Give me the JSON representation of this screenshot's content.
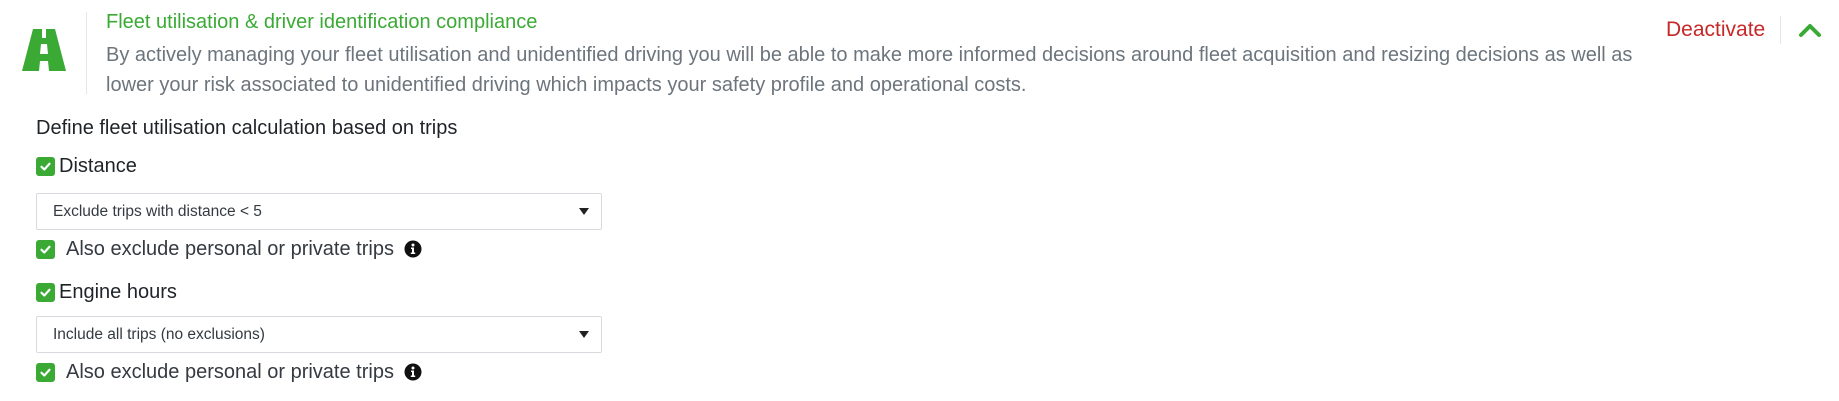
{
  "header": {
    "icon": "road-icon",
    "title": "Fleet utilisation & driver identification compliance",
    "description": "By actively managing your fleet utilisation and unidentified driving you will be able to make more informed decisions around fleet acquisition and resizing decisions as well as lower your risk associated to unidentified driving which impacts your safety profile and operational costs.",
    "deactivate_label": "Deactivate",
    "collapse_icon": "chevron-up-icon"
  },
  "section": {
    "heading": "Define fleet utilisation calculation based on trips",
    "distance": {
      "label": "Distance",
      "checked": true,
      "select_value": "Exclude trips with distance < 5",
      "exclude_personal_label": "Also exclude personal or private trips",
      "exclude_personal_checked": true
    },
    "engine_hours": {
      "label": "Engine hours",
      "checked": true,
      "select_value": "Include all trips (no exclusions)",
      "exclude_personal_label": "Also exclude personal or private trips",
      "exclude_personal_checked": true
    }
  },
  "colors": {
    "accent_green": "#3aaa35",
    "deactivate_red": "#c62828",
    "description_gray": "#6c757d"
  }
}
